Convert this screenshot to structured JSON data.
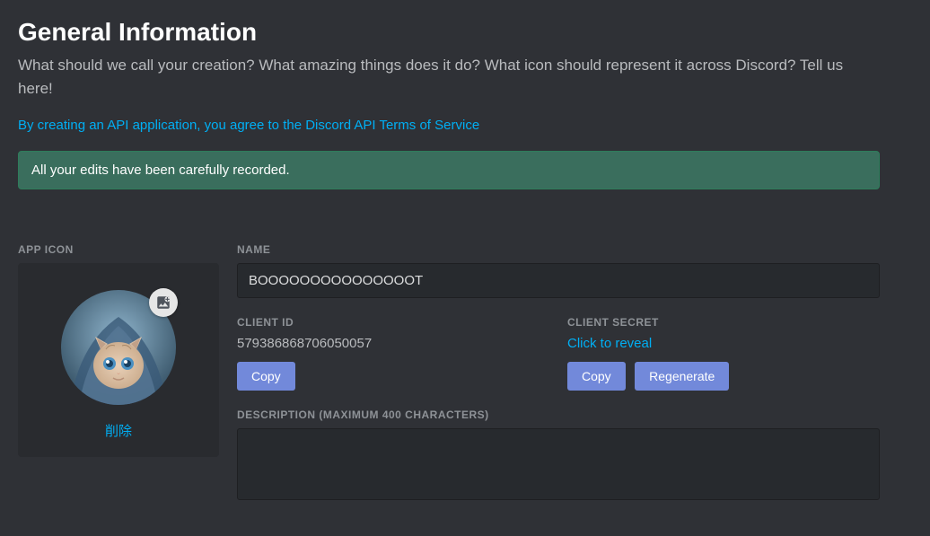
{
  "header": {
    "title": "General Information",
    "subtitle": "What should we call your creation? What amazing things does it do? What icon should represent it across Discord? Tell us here!",
    "tos_text": "By creating an API application, you agree to the Discord API Terms of Service"
  },
  "banner": {
    "text": "All your edits have been carefully recorded."
  },
  "app_icon": {
    "label": "APP ICON",
    "delete_label": "削除"
  },
  "name": {
    "label": "NAME",
    "value": "BOOOOOOOOOOOOOOOT"
  },
  "client_id": {
    "label": "CLIENT ID",
    "value": "579386868706050057",
    "copy_label": "Copy"
  },
  "client_secret": {
    "label": "CLIENT SECRET",
    "reveal_label": "Click to reveal",
    "copy_label": "Copy",
    "regenerate_label": "Regenerate"
  },
  "description": {
    "label": "DESCRIPTION (MAXIMUM 400 CHARACTERS)",
    "value": ""
  }
}
